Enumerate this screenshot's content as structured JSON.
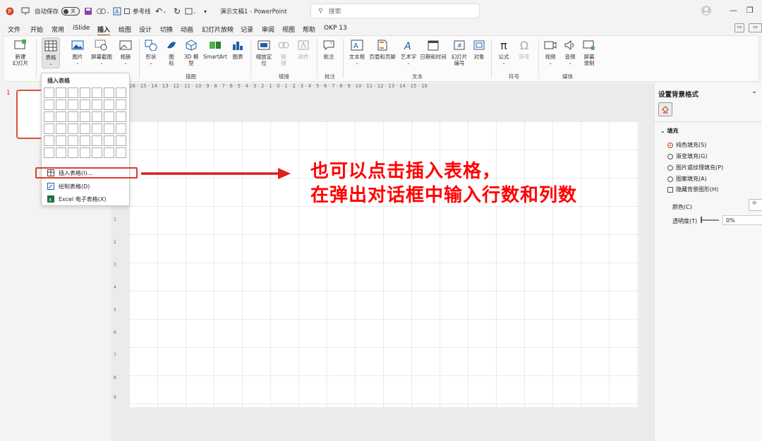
{
  "titlebar": {
    "autosave_label": "自动保存",
    "autosave_state": "关",
    "ref_label": "参考线",
    "doc_title": "演示文稿1 - PowerPoint",
    "search_placeholder": "搜索"
  },
  "menu": [
    "文件",
    "开始",
    "常用",
    "iSlide",
    "插入",
    "绘图",
    "设计",
    "切换",
    "动画",
    "幻灯片放映",
    "记录",
    "审阅",
    "视图",
    "帮助",
    "OKP 13"
  ],
  "ribbon": {
    "new_slide": "新建\n幻灯片",
    "table": "表格",
    "picture": "图片",
    "screenshot": "屏幕截图",
    "album": "相册",
    "shapes": "形状",
    "icons": "图\n标",
    "model3d": "3D 模\n型",
    "smartart": "SmartArt",
    "chart": "图表",
    "zoom": "缩放定\n位",
    "link": "链\n接",
    "action": "动作",
    "comment": "批注",
    "textbox": "文本框",
    "header_footer": "页眉和页脚",
    "wordart": "艺术字",
    "datetime": "日期和时间",
    "slide_number": "幻灯片\n编号",
    "object": "对象",
    "formula": "公式",
    "symbol": "符号",
    "video": "视频",
    "audio": "音频",
    "screen_record": "屏幕\n录制",
    "groups": {
      "slides": "幻灯片",
      "illustrations": "插图",
      "links": "链接",
      "comments": "批注",
      "text": "文本",
      "symbols": "符号",
      "media": "媒体"
    }
  },
  "slide_number": "1",
  "ruler_text": "16 · 15 · 14 · 13 · 12 · 11 · 10 · 9 · 8 · 7 · 6 · 5 · 4 · 3 · 2 · 1 · 0 · 1 · 2 · 3 · 4 · 5 · 6 · 7 · 8 · 9 · 10 · 11 · 12 · 13 · 14 · 15 · 16",
  "vruler": [
    "3",
    "2",
    "1",
    "0",
    "1",
    "2",
    "3",
    "4",
    "5",
    "6",
    "7",
    "8",
    "9"
  ],
  "dropdown": {
    "title": "插入表格",
    "items": [
      "插入表格(I)...",
      "绘制表格(D)",
      "Excel 电子表格(X)"
    ]
  },
  "annotation": {
    "line1": "也可以点击插入表格，",
    "line2": "在弹出对话框中输入行数和列数",
    "color": "#ff0000"
  },
  "right_pane": {
    "title": "设置背景格式",
    "section": "填充",
    "options": [
      "纯色填充(S)",
      "渐变填充(G)",
      "图片或纹理填充(P)",
      "图案填充(A)"
    ],
    "hide_bg": "隐藏背景图形(H)",
    "color_label": "颜色(C)",
    "transparency_label": "透明度(T)",
    "transparency_value": "0%"
  },
  "accent": "#c43e1c"
}
